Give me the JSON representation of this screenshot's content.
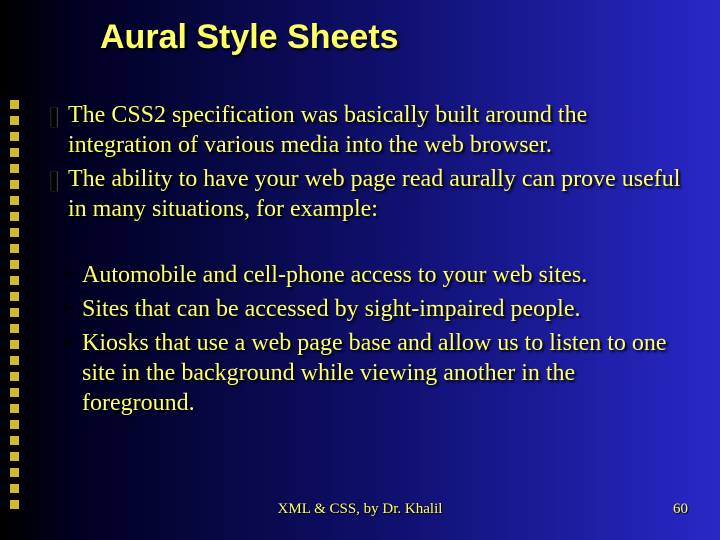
{
  "title": "Aural Style Sheets",
  "bullets": [
    "The CSS2 specification was basically built around the integration of various media into the web browser.",
    "The ability to have your web page read aurally can prove useful in many situations, for example:"
  ],
  "arrows": [
    "Automobile and cell-phone access to your web sites.",
    "Sites that can be accessed by sight-impaired people.",
    "Kiosks that use a web page base and allow us to listen to one site in the background while viewing another in the foreground."
  ],
  "footer": {
    "center": "XML & CSS, by Dr. Khalil",
    "page": "60"
  }
}
